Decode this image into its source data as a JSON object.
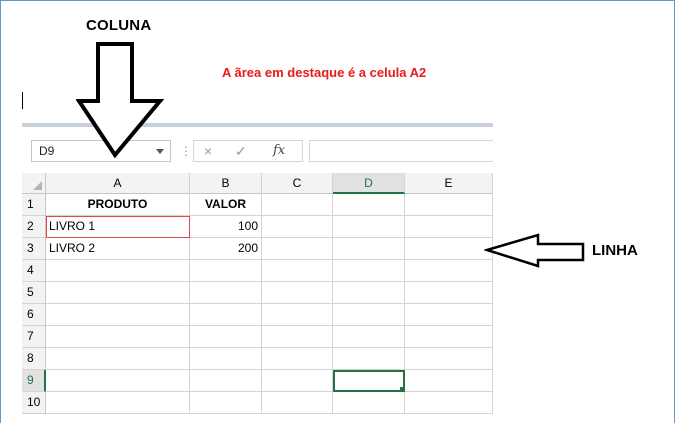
{
  "annotations": {
    "column_label": "COLUNA",
    "row_label": "LINHA",
    "headline": "A ãrea em destaque é a celula A2",
    "headline_color": "#e81a1a"
  },
  "formula_bar": {
    "name_box": "D9",
    "separator": "⋮",
    "cancel_icon": "×",
    "enter_icon": "✓",
    "function_icon": "fx",
    "formula_value": ""
  },
  "sheet": {
    "columns": [
      "A",
      "B",
      "C",
      "D",
      "E"
    ],
    "selected_column": "D",
    "selected_row": 9,
    "rows": [
      {
        "n": "1",
        "cells": [
          "PRODUTO",
          "VALOR",
          "",
          "",
          ""
        ]
      },
      {
        "n": "2",
        "cells": [
          "LIVRO 1",
          "100",
          "",
          "",
          ""
        ]
      },
      {
        "n": "3",
        "cells": [
          "LIVRO 2",
          "200",
          "",
          "",
          ""
        ]
      },
      {
        "n": "4",
        "cells": [
          "",
          "",
          "",
          "",
          ""
        ]
      },
      {
        "n": "5",
        "cells": [
          "",
          "",
          "",
          "",
          ""
        ]
      },
      {
        "n": "6",
        "cells": [
          "",
          "",
          "",
          "",
          ""
        ]
      },
      {
        "n": "7",
        "cells": [
          "",
          "",
          "",
          "",
          ""
        ]
      },
      {
        "n": "8",
        "cells": [
          "",
          "",
          "",
          "",
          ""
        ]
      },
      {
        "n": "9",
        "cells": [
          "",
          "",
          "",
          "",
          ""
        ]
      },
      {
        "n": "10",
        "cells": [
          "",
          "",
          "",
          "",
          ""
        ]
      }
    ],
    "accent_color": "#217346",
    "highlight_cell": "A2",
    "highlight_color": "#e0484b"
  }
}
